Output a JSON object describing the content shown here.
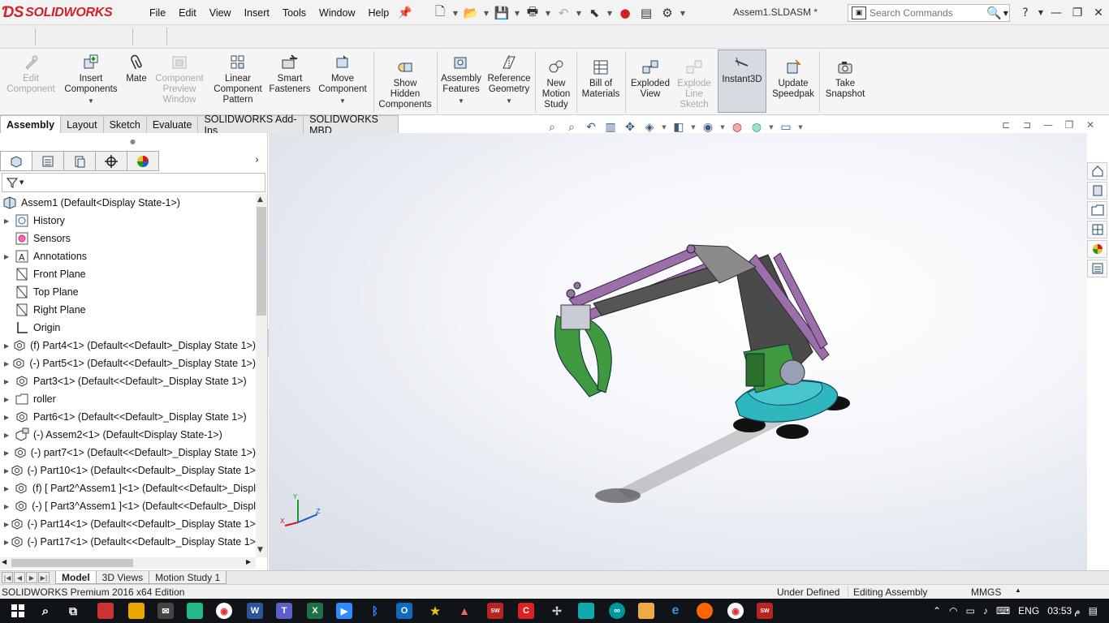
{
  "app": {
    "brand": "SOLIDWORKS",
    "doc_title": "Assem1.SLDASM *"
  },
  "menu": [
    "File",
    "Edit",
    "View",
    "Insert",
    "Tools",
    "Window",
    "Help"
  ],
  "search": {
    "placeholder": "Search Commands"
  },
  "commands": {
    "edit_component": "Edit Component",
    "insert_components": "Insert Components",
    "mate": "Mate",
    "component_preview": "Component Preview Window",
    "linear_pattern": "Linear Component Pattern",
    "smart_fasteners": "Smart Fasteners",
    "move_component": "Move Component",
    "show_hidden": "Show Hidden Components",
    "assembly_features": "Assembly Features",
    "reference_geometry": "Reference Geometry",
    "new_motion": "New Motion Study",
    "bom": "Bill of Materials",
    "exploded_view": "Exploded View",
    "explode_line": "Explode Line Sketch",
    "instant3d": "Instant3D",
    "update_speedpak": "Update Speedpak",
    "take_snapshot": "Take Snapshot"
  },
  "tabs": [
    "Assembly",
    "Layout",
    "Sketch",
    "Evaluate",
    "SOLIDWORKS Add-Ins",
    "SOLIDWORKS MBD"
  ],
  "tree": {
    "root": "Assem1  (Default<Display State-1>)",
    "items": [
      "History",
      "Sensors",
      "Annotations",
      "Front Plane",
      "Top Plane",
      "Right Plane",
      "Origin",
      "(f) Part4<1> (Default<<Default>_Display State 1>)",
      "(-) Part5<1> (Default<<Default>_Display State 1>)",
      "Part3<1> (Default<<Default>_Display State 1>)",
      "roller",
      "Part6<1> (Default<<Default>_Display State 1>)",
      "(-) Assem2<1> (Default<Display State-1>)",
      "(-) part7<1> (Default<<Default>_Display State 1>)",
      "(-) Part10<1> (Default<<Default>_Display State 1>",
      "(f) [ Part2^Assem1 ]<1> (Default<<Default>_Displ",
      "(-) [ Part3^Assem1 ]<1> (Default<<Default>_Displ",
      "(-) Part14<1> (Default<<Default>_Display State 1>",
      "(-) Part17<1> (Default<<Default>_Display State 1>"
    ]
  },
  "triad": {
    "x": "X",
    "y": "Y",
    "z": "Z"
  },
  "bottom_tabs": [
    "Model",
    "3D Views",
    "Motion Study 1"
  ],
  "status": {
    "edition": "SOLIDWORKS Premium 2016 x64 Edition",
    "defined": "Under Defined",
    "mode": "Editing Assembly",
    "units": "MMGS"
  },
  "tray": {
    "lang": "ENG",
    "time": "03:53",
    "ampm": "م"
  },
  "colors": {
    "brand": "#d3202a",
    "arm": "#9b6fa8",
    "base": "#2fb7bf",
    "gripper": "#3f9a3f",
    "column": "#4a4a4a"
  }
}
